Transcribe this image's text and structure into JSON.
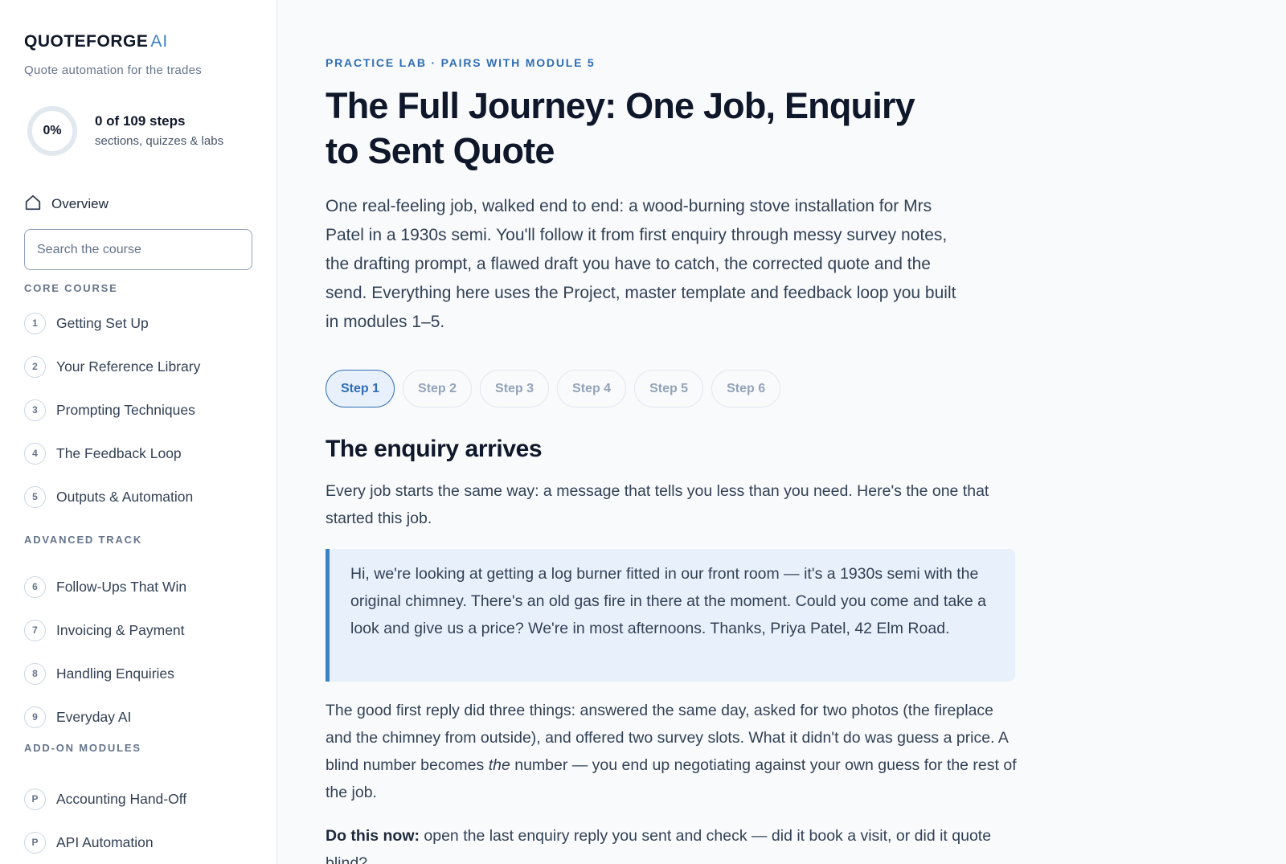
{
  "brand": {
    "name": "QUOTEFORGE",
    "suffix": "AI",
    "tagline": "Quote automation for the trades"
  },
  "progress": {
    "percent": "0%",
    "summary": "0 of 109 steps",
    "detail": "sections, quizzes & labs",
    "value": 0
  },
  "sidebar": {
    "overview_label": "Overview",
    "search_placeholder": "Search the course",
    "core_heading": "CORE COURSE",
    "core_items": [
      {
        "num": "1",
        "label": "Getting Set Up"
      },
      {
        "num": "2",
        "label": "Your Reference Library"
      },
      {
        "num": "3",
        "label": "Prompting Techniques"
      },
      {
        "num": "4",
        "label": "The Feedback Loop"
      },
      {
        "num": "5",
        "label": "Outputs & Automation"
      }
    ],
    "advanced_heading": "ADVANCED TRACK",
    "advanced_items": [
      {
        "num": "6",
        "label": "Follow-Ups That Win"
      },
      {
        "num": "7",
        "label": "Invoicing & Payment"
      },
      {
        "num": "8",
        "label": "Handling Enquiries"
      },
      {
        "num": "9",
        "label": "Everyday AI"
      }
    ],
    "addon_heading": "ADD-ON MODULES",
    "addon_items": [
      {
        "num": "P",
        "label": "Accounting Hand-Off"
      },
      {
        "num": "P",
        "label": "API Automation"
      }
    ]
  },
  "main": {
    "eyebrow": "PRACTICE LAB · PAIRS WITH MODULE 5",
    "title": "The Full Journey: One Job, Enquiry to Sent Quote",
    "intro": "One real-feeling job, walked end to end: a wood-burning stove installation for Mrs Patel in a 1930s semi. You'll follow it from first enquiry through messy survey notes, the drafting prompt, a flawed draft you have to catch, the corrected quote and the send. Everything here uses the Project, master template and feedback loop you built in modules 1–5.",
    "steps": [
      "Step 1",
      "Step 2",
      "Step 3",
      "Step 4",
      "Step 5",
      "Step 6"
    ],
    "active_step": "Step 1",
    "step_title": "The enquiry arrives",
    "para1": "Every job starts the same way: a message that tells you less than you need. Here's the one that started this job.",
    "quote": "Hi, we're looking at getting a log burner fitted in our front room — it's a 1930s semi with the original chimney. There's an old gas fire in there at the moment. Could you come and take a look and give us a price? We're in most afternoons. Thanks, Priya Patel, 42 Elm Road.",
    "para2_before": "The good first reply did three things: answered the same day, asked for two photos (the fireplace and the chimney from outside), and offered two survey slots. What it didn't do was guess a price. A blind number becomes ",
    "para2_em": "the",
    "para2_after": " number — you end up negotiating against your own guess for the rest of the job.",
    "para3_strong": "Do this now:",
    "para3_rest": " open the last enquiry reply you sent and check — did it book a visit, or did it quote blind?"
  },
  "colors": {
    "accent": "#2f6db5",
    "accent_light": "#e8f1fb",
    "quote_border": "#3b82c4"
  }
}
